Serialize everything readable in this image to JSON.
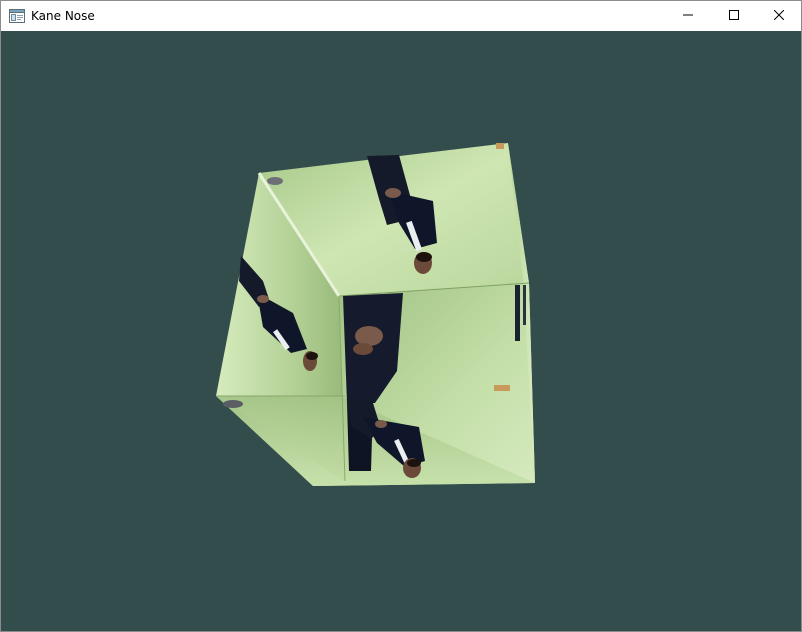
{
  "window": {
    "title": "Kane Nose",
    "icon": "app-window-icon",
    "controls": {
      "minimize": "minimize-icon",
      "maximize": "maximize-icon",
      "close": "close-icon"
    }
  },
  "scene": {
    "clear_color": "#334d4d",
    "object": "rotating-textured-cube",
    "texture_colors": {
      "wall_light": "#c8e0a8",
      "wall_mid": "#a9c98a",
      "suit": "#141a2a",
      "shirt": "#e9eef0",
      "skin": "#6b4a3a"
    }
  }
}
